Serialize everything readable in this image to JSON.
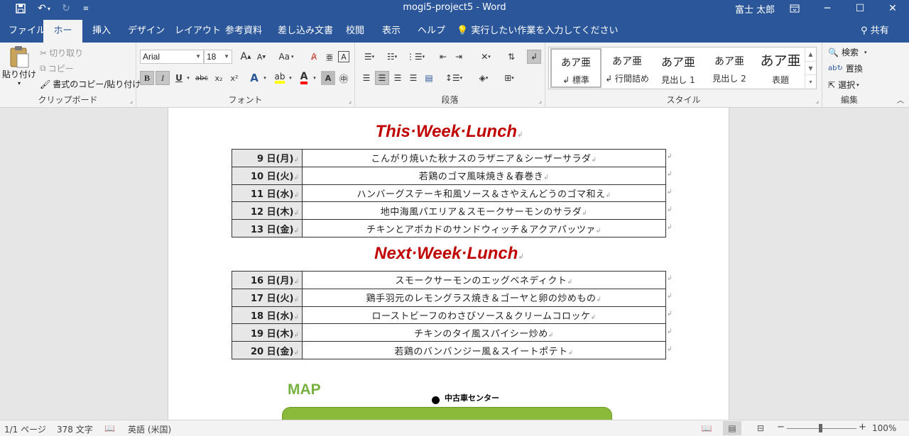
{
  "titlebar": {
    "title": "mogi5-project5  -  Word",
    "user": "富士 太郎",
    "icons": {
      "save": "save-icon",
      "undo": "undo-icon",
      "redo": "redo-icon",
      "customize": "customize-qat-icon"
    }
  },
  "tabs": [
    "ファイル",
    "ホーム",
    "挿入",
    "デザイン",
    "レイアウト",
    "参考資料",
    "差し込み文書",
    "校閲",
    "表示",
    "ヘルプ"
  ],
  "active_tab": "ホーム",
  "tell_me": "実行したい作業を入力してください",
  "share": "共有",
  "clipboard": {
    "paste": "貼り付け",
    "cut": "切り取り",
    "copy": "コピー",
    "format_painter": "書式のコピー/貼り付け",
    "label": "クリップボード"
  },
  "font": {
    "family": "Arial",
    "size": "18",
    "grow": "A",
    "shrink": "A",
    "case": "Aa",
    "label": "フォント",
    "bold": "B",
    "italic": "I",
    "underline": "U",
    "strike": "abc",
    "subscript": "x₂",
    "superscript": "x²",
    "highlight_color": "#ffff00",
    "font_color": "#ff0000"
  },
  "paragraph": {
    "label": "段落"
  },
  "styles": {
    "label": "スタイル",
    "items": [
      {
        "sample": "あア亜",
        "name": "↲ 標準"
      },
      {
        "sample": "あア亜",
        "name": "↲ 行間詰め"
      },
      {
        "sample": "あア亜",
        "name": "見出し 1"
      },
      {
        "sample": "あア亜",
        "name": "見出し 2"
      },
      {
        "sample": "あア亜",
        "name": "表題"
      }
    ]
  },
  "editing": {
    "label": "編集",
    "find": "検索",
    "replace": "置換",
    "select": "選択"
  },
  "document": {
    "this_week": {
      "title": "This·Week·Lunch",
      "rows": [
        {
          "day": "9 日(月)",
          "meal": "こんがり焼いた秋ナスのラザニア＆シーザーサラダ"
        },
        {
          "day": "10 日(火)",
          "meal": "若鶏のゴマ風味焼き＆春巻き"
        },
        {
          "day": "11 日(水)",
          "meal": "ハンバーグステーキ和風ソース＆さやえんどうのゴマ和え"
        },
        {
          "day": "12 日(木)",
          "meal": "地中海風パエリア＆スモークサーモンのサラダ"
        },
        {
          "day": "13 日(金)",
          "meal": "チキンとアボカドのサンドウィッチ＆アクアパッツァ"
        }
      ]
    },
    "next_week": {
      "title": "Next·Week·Lunch",
      "rows": [
        {
          "day": "16 日(月)",
          "meal": "スモークサーモンのエッグベネディクト"
        },
        {
          "day": "17 日(火)",
          "meal": "鶏手羽元のレモングラス焼き＆ゴーヤと卵の炒めもの"
        },
        {
          "day": "18 日(水)",
          "meal": "ローストビーフのわさびソース＆クリームコロッケ"
        },
        {
          "day": "19 日(木)",
          "meal": "チキンのタイ風スパイシー炒め"
        },
        {
          "day": "20 日(金)",
          "meal": "若鶏のバンバンジー風＆スイートポテト"
        }
      ]
    },
    "map_title": "MAP",
    "map_label": "中古車センター",
    "heading_color": "#c00000",
    "map_color": "#77b241"
  },
  "status": {
    "page": "1/1 ページ",
    "words": "378 文字",
    "language": "英語 (米国)",
    "zoom": "100%",
    "zoom_minus": "−",
    "zoom_plus": "+"
  }
}
